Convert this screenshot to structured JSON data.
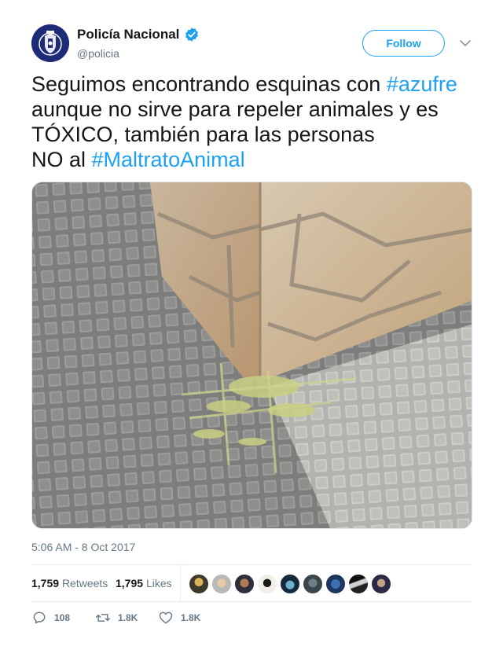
{
  "author": {
    "display_name": "Policía Nacional",
    "handle": "@policia",
    "verified": true,
    "avatar_icon": "police-badge-icon"
  },
  "follow_label": "Follow",
  "tweet": {
    "segments": [
      [
        {
          "text": "Seguimos encontrando esquinas con "
        },
        {
          "text": "#azufre",
          "hashtag": true
        }
      ],
      [
        {
          "text": "aunque no sirve para repeler animales y es"
        }
      ],
      [
        {
          "text": "TÓXICO, también para las personas"
        }
      ],
      [
        {
          "text": "NO al "
        },
        {
          "text": "#MaltratoAnimal",
          "hashtag": true
        }
      ]
    ]
  },
  "timestamp": "5:06 AM - 8 Oct 2017",
  "stats": {
    "retweets_count": "1,759",
    "retweets_label": "Retweets",
    "likes_count": "1,795",
    "likes_label": "Likes"
  },
  "actions": {
    "reply_count": "108",
    "retweet_count": "1.8K",
    "like_count": "1.8K"
  },
  "colors": {
    "accent": "#1da1f2",
    "text": "#14171a",
    "muted": "#657786"
  }
}
